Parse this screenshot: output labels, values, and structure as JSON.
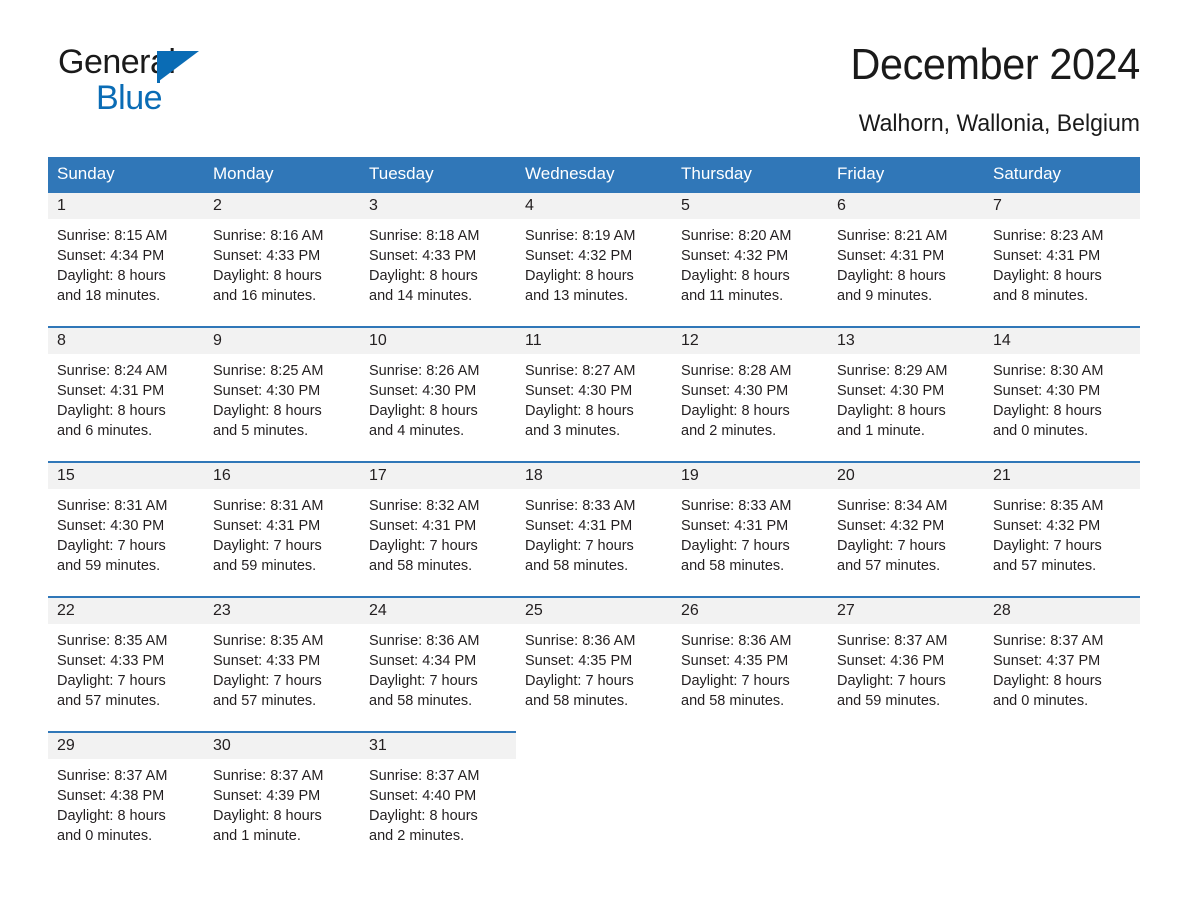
{
  "brand": {
    "name_top": "General",
    "name_bottom": "Blue",
    "accent_color": "#0a6cb5"
  },
  "header": {
    "title": "December 2024",
    "location": "Walhorn, Wallonia, Belgium"
  },
  "calendar": {
    "header_bg": "#3077b8",
    "daynum_bg": "#f2f2f2",
    "weekdays": [
      "Sunday",
      "Monday",
      "Tuesday",
      "Wednesday",
      "Thursday",
      "Friday",
      "Saturday"
    ],
    "weeks": [
      [
        {
          "day": "1",
          "sunrise": "Sunrise: 8:15 AM",
          "sunset": "Sunset: 4:34 PM",
          "daylight1": "Daylight: 8 hours",
          "daylight2": "and 18 minutes."
        },
        {
          "day": "2",
          "sunrise": "Sunrise: 8:16 AM",
          "sunset": "Sunset: 4:33 PM",
          "daylight1": "Daylight: 8 hours",
          "daylight2": "and 16 minutes."
        },
        {
          "day": "3",
          "sunrise": "Sunrise: 8:18 AM",
          "sunset": "Sunset: 4:33 PM",
          "daylight1": "Daylight: 8 hours",
          "daylight2": "and 14 minutes."
        },
        {
          "day": "4",
          "sunrise": "Sunrise: 8:19 AM",
          "sunset": "Sunset: 4:32 PM",
          "daylight1": "Daylight: 8 hours",
          "daylight2": "and 13 minutes."
        },
        {
          "day": "5",
          "sunrise": "Sunrise: 8:20 AM",
          "sunset": "Sunset: 4:32 PM",
          "daylight1": "Daylight: 8 hours",
          "daylight2": "and 11 minutes."
        },
        {
          "day": "6",
          "sunrise": "Sunrise: 8:21 AM",
          "sunset": "Sunset: 4:31 PM",
          "daylight1": "Daylight: 8 hours",
          "daylight2": "and 9 minutes."
        },
        {
          "day": "7",
          "sunrise": "Sunrise: 8:23 AM",
          "sunset": "Sunset: 4:31 PM",
          "daylight1": "Daylight: 8 hours",
          "daylight2": "and 8 minutes."
        }
      ],
      [
        {
          "day": "8",
          "sunrise": "Sunrise: 8:24 AM",
          "sunset": "Sunset: 4:31 PM",
          "daylight1": "Daylight: 8 hours",
          "daylight2": "and 6 minutes."
        },
        {
          "day": "9",
          "sunrise": "Sunrise: 8:25 AM",
          "sunset": "Sunset: 4:30 PM",
          "daylight1": "Daylight: 8 hours",
          "daylight2": "and 5 minutes."
        },
        {
          "day": "10",
          "sunrise": "Sunrise: 8:26 AM",
          "sunset": "Sunset: 4:30 PM",
          "daylight1": "Daylight: 8 hours",
          "daylight2": "and 4 minutes."
        },
        {
          "day": "11",
          "sunrise": "Sunrise: 8:27 AM",
          "sunset": "Sunset: 4:30 PM",
          "daylight1": "Daylight: 8 hours",
          "daylight2": "and 3 minutes."
        },
        {
          "day": "12",
          "sunrise": "Sunrise: 8:28 AM",
          "sunset": "Sunset: 4:30 PM",
          "daylight1": "Daylight: 8 hours",
          "daylight2": "and 2 minutes."
        },
        {
          "day": "13",
          "sunrise": "Sunrise: 8:29 AM",
          "sunset": "Sunset: 4:30 PM",
          "daylight1": "Daylight: 8 hours",
          "daylight2": "and 1 minute."
        },
        {
          "day": "14",
          "sunrise": "Sunrise: 8:30 AM",
          "sunset": "Sunset: 4:30 PM",
          "daylight1": "Daylight: 8 hours",
          "daylight2": "and 0 minutes."
        }
      ],
      [
        {
          "day": "15",
          "sunrise": "Sunrise: 8:31 AM",
          "sunset": "Sunset: 4:30 PM",
          "daylight1": "Daylight: 7 hours",
          "daylight2": "and 59 minutes."
        },
        {
          "day": "16",
          "sunrise": "Sunrise: 8:31 AM",
          "sunset": "Sunset: 4:31 PM",
          "daylight1": "Daylight: 7 hours",
          "daylight2": "and 59 minutes."
        },
        {
          "day": "17",
          "sunrise": "Sunrise: 8:32 AM",
          "sunset": "Sunset: 4:31 PM",
          "daylight1": "Daylight: 7 hours",
          "daylight2": "and 58 minutes."
        },
        {
          "day": "18",
          "sunrise": "Sunrise: 8:33 AM",
          "sunset": "Sunset: 4:31 PM",
          "daylight1": "Daylight: 7 hours",
          "daylight2": "and 58 minutes."
        },
        {
          "day": "19",
          "sunrise": "Sunrise: 8:33 AM",
          "sunset": "Sunset: 4:31 PM",
          "daylight1": "Daylight: 7 hours",
          "daylight2": "and 58 minutes."
        },
        {
          "day": "20",
          "sunrise": "Sunrise: 8:34 AM",
          "sunset": "Sunset: 4:32 PM",
          "daylight1": "Daylight: 7 hours",
          "daylight2": "and 57 minutes."
        },
        {
          "day": "21",
          "sunrise": "Sunrise: 8:35 AM",
          "sunset": "Sunset: 4:32 PM",
          "daylight1": "Daylight: 7 hours",
          "daylight2": "and 57 minutes."
        }
      ],
      [
        {
          "day": "22",
          "sunrise": "Sunrise: 8:35 AM",
          "sunset": "Sunset: 4:33 PM",
          "daylight1": "Daylight: 7 hours",
          "daylight2": "and 57 minutes."
        },
        {
          "day": "23",
          "sunrise": "Sunrise: 8:35 AM",
          "sunset": "Sunset: 4:33 PM",
          "daylight1": "Daylight: 7 hours",
          "daylight2": "and 57 minutes."
        },
        {
          "day": "24",
          "sunrise": "Sunrise: 8:36 AM",
          "sunset": "Sunset: 4:34 PM",
          "daylight1": "Daylight: 7 hours",
          "daylight2": "and 58 minutes."
        },
        {
          "day": "25",
          "sunrise": "Sunrise: 8:36 AM",
          "sunset": "Sunset: 4:35 PM",
          "daylight1": "Daylight: 7 hours",
          "daylight2": "and 58 minutes."
        },
        {
          "day": "26",
          "sunrise": "Sunrise: 8:36 AM",
          "sunset": "Sunset: 4:35 PM",
          "daylight1": "Daylight: 7 hours",
          "daylight2": "and 58 minutes."
        },
        {
          "day": "27",
          "sunrise": "Sunrise: 8:37 AM",
          "sunset": "Sunset: 4:36 PM",
          "daylight1": "Daylight: 7 hours",
          "daylight2": "and 59 minutes."
        },
        {
          "day": "28",
          "sunrise": "Sunrise: 8:37 AM",
          "sunset": "Sunset: 4:37 PM",
          "daylight1": "Daylight: 8 hours",
          "daylight2": "and 0 minutes."
        }
      ],
      [
        {
          "day": "29",
          "sunrise": "Sunrise: 8:37 AM",
          "sunset": "Sunset: 4:38 PM",
          "daylight1": "Daylight: 8 hours",
          "daylight2": "and 0 minutes."
        },
        {
          "day": "30",
          "sunrise": "Sunrise: 8:37 AM",
          "sunset": "Sunset: 4:39 PM",
          "daylight1": "Daylight: 8 hours",
          "daylight2": "and 1 minute."
        },
        {
          "day": "31",
          "sunrise": "Sunrise: 8:37 AM",
          "sunset": "Sunset: 4:40 PM",
          "daylight1": "Daylight: 8 hours",
          "daylight2": "and 2 minutes."
        },
        {
          "day": "",
          "sunrise": "",
          "sunset": "",
          "daylight1": "",
          "daylight2": "",
          "empty": true
        },
        {
          "day": "",
          "sunrise": "",
          "sunset": "",
          "daylight1": "",
          "daylight2": "",
          "empty": true
        },
        {
          "day": "",
          "sunrise": "",
          "sunset": "",
          "daylight1": "",
          "daylight2": "",
          "empty": true
        },
        {
          "day": "",
          "sunrise": "",
          "sunset": "",
          "daylight1": "",
          "daylight2": "",
          "empty": true
        }
      ]
    ]
  }
}
